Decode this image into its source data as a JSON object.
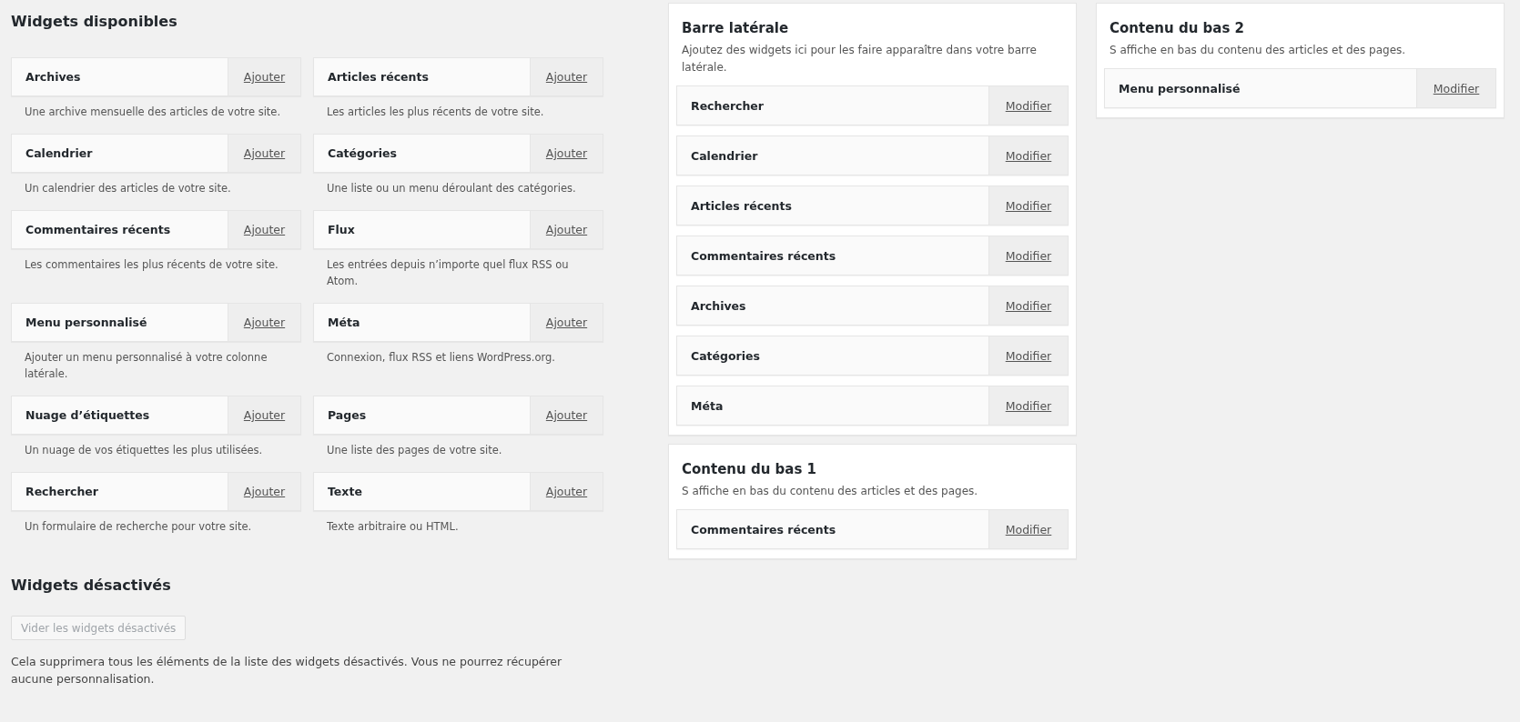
{
  "available": {
    "title": "Widgets disponibles",
    "widgets": [
      {
        "title": "Archives",
        "action": "Ajouter",
        "description": "Une archive mensuelle des articles de votre site."
      },
      {
        "title": "Articles récents",
        "action": "Ajouter",
        "description": "Les articles les plus récents de votre site."
      },
      {
        "title": "Calendrier",
        "action": "Ajouter",
        "description": "Un calendrier des articles de votre site."
      },
      {
        "title": "Catégories",
        "action": "Ajouter",
        "description": "Une liste ou un menu déroulant des catégories."
      },
      {
        "title": "Commentaires récents",
        "action": "Ajouter",
        "description": "Les commentaires les plus récents de votre site."
      },
      {
        "title": "Flux",
        "action": "Ajouter",
        "description": "Les entrées depuis n’importe quel flux RSS ou Atom."
      },
      {
        "title": "Menu personnalisé",
        "action": "Ajouter",
        "description": "Ajouter un menu personnalisé à votre colonne latérale."
      },
      {
        "title": "Méta",
        "action": "Ajouter",
        "description": "Connexion, flux RSS et liens WordPress.org."
      },
      {
        "title": "Nuage d’étiquettes",
        "action": "Ajouter",
        "description": "Un nuage de vos étiquettes les plus utilisées."
      },
      {
        "title": "Pages",
        "action": "Ajouter",
        "description": "Une liste des pages de votre site."
      },
      {
        "title": "Rechercher",
        "action": "Ajouter",
        "description": "Un formulaire de recherche pour votre site."
      },
      {
        "title": "Texte",
        "action": "Ajouter",
        "description": "Texte arbitraire ou HTML."
      }
    ]
  },
  "inactive": {
    "title": "Widgets désactivés",
    "button": {
      "label": "Vider les widgets désactivés",
      "disabled": true
    },
    "note": "Cela supprimera tous les éléments de la liste des widgets désactivés. Vous ne pourrez récupérer aucune personnalisation."
  },
  "areas": [
    {
      "title": "Barre latérale",
      "description": "Ajoutez des widgets ici pour les faire apparaître dans votre barre latérale.",
      "widgets": [
        {
          "title": "Rechercher",
          "action": "Modifier"
        },
        {
          "title": "Calendrier",
          "action": "Modifier"
        },
        {
          "title": "Articles récents",
          "action": "Modifier"
        },
        {
          "title": "Commentaires récents",
          "action": "Modifier"
        },
        {
          "title": "Archives",
          "action": "Modifier"
        },
        {
          "title": "Catégories",
          "action": "Modifier"
        },
        {
          "title": "Méta",
          "action": "Modifier"
        }
      ]
    },
    {
      "title": "Contenu du bas 1",
      "description": "S affiche en bas du contenu des articles et des pages.",
      "widgets": [
        {
          "title": "Commentaires récents",
          "action": "Modifier"
        }
      ]
    },
    {
      "title": "Contenu du bas 2",
      "description": "S affiche en bas du contenu des articles et des pages.",
      "widgets": [
        {
          "title": "Menu personnalisé",
          "action": "Modifier"
        }
      ]
    }
  ]
}
